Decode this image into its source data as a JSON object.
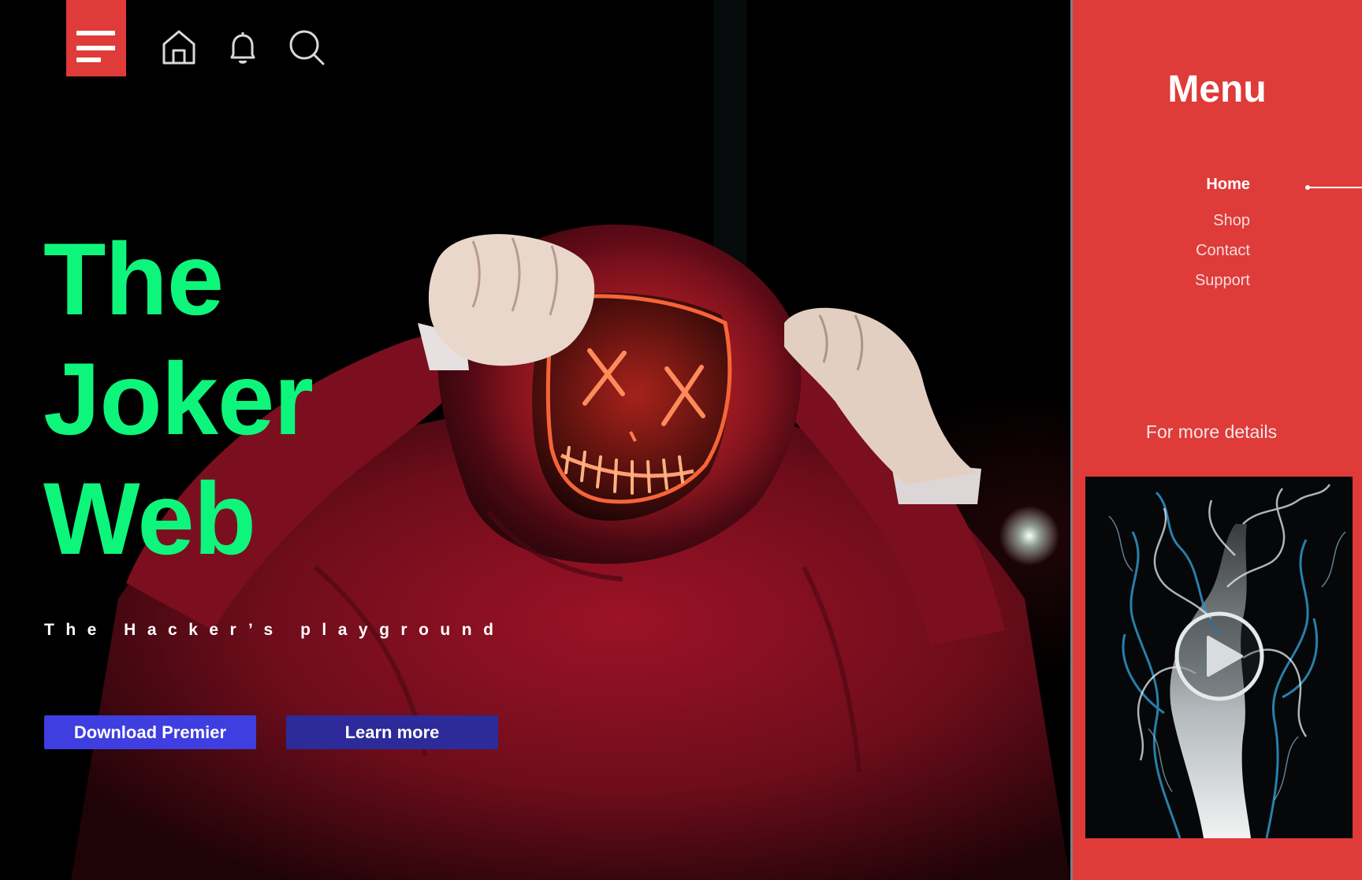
{
  "toolbar": {
    "menu_icon": "hamburger-menu-icon",
    "home_icon": "home-icon",
    "bell_icon": "bell-icon",
    "search_icon": "search-icon"
  },
  "hero": {
    "title_lines": [
      "The",
      "Joker",
      "Web"
    ],
    "tagline": "The Hacker’s playground",
    "download_button": "Download Premier",
    "learn_button": "Learn more"
  },
  "side_menu": {
    "title": "Menu",
    "items": [
      {
        "label": "Home",
        "active": true
      },
      {
        "label": "Shop",
        "active": false
      },
      {
        "label": "Contact",
        "active": false
      },
      {
        "label": "Support",
        "active": false
      }
    ],
    "details_label": "For more details",
    "video_icon": "play-icon"
  },
  "colors": {
    "accent_red": "#de3b39",
    "title_green": "#0ef57c",
    "button_primary": "#3f3ee0",
    "button_secondary": "#2d2a9a",
    "background": "#000000"
  }
}
